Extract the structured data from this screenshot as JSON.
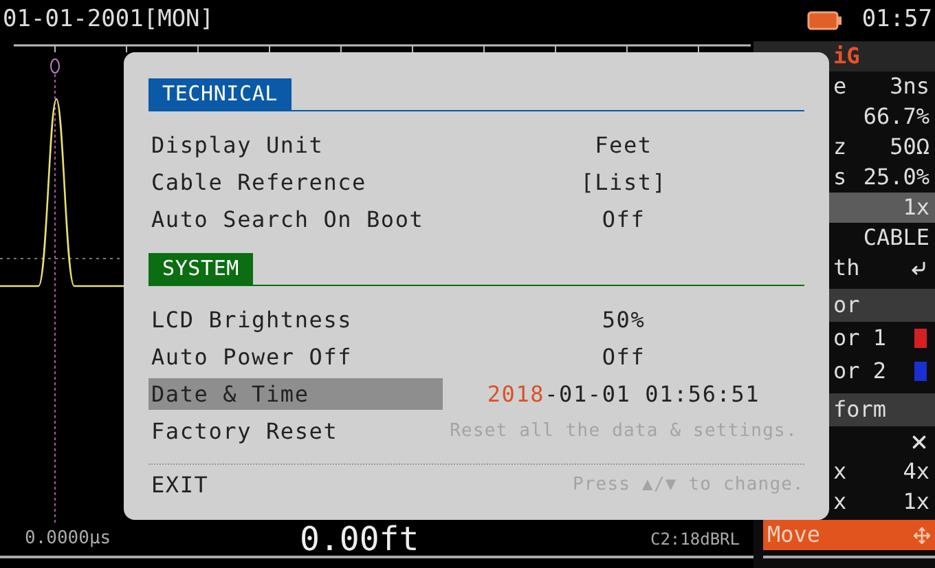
{
  "status_bar": {
    "date": "01-01-2001[MON]",
    "time": "01:57"
  },
  "readout": {
    "time": "0.0000µs",
    "distance": "0.00ft",
    "channel": "C2:18dBRL"
  },
  "config_panel": {
    "title": "iG",
    "rows": [
      {
        "kind": "value",
        "label": "e",
        "value": "3ns",
        "selected": false
      },
      {
        "kind": "value",
        "value": "66.7%",
        "selected": false
      },
      {
        "kind": "value",
        "label": "z",
        "value": "50Ω",
        "selected": false
      },
      {
        "kind": "value",
        "label": "s",
        "value": "25.0%",
        "selected": false
      },
      {
        "kind": "value",
        "value": "1x",
        "selected": true
      },
      {
        "kind": "value",
        "value": "CABLE",
        "selected": false
      },
      {
        "kind": "enter",
        "label": "th",
        "selected": false
      },
      {
        "kind": "header",
        "label": "or",
        "selected": false
      },
      {
        "kind": "swatch",
        "label": "or 1",
        "color": "#d42020",
        "selected": false
      },
      {
        "kind": "swatch",
        "label": "or 2",
        "color": "#1a2fd0",
        "selected": false
      },
      {
        "kind": "header",
        "label": "form",
        "selected": false
      },
      {
        "kind": "close",
        "selected": false
      },
      {
        "kind": "value",
        "label": "x",
        "value": "4x",
        "selected": false
      },
      {
        "kind": "value",
        "label": "x",
        "value": "1x",
        "selected": false
      },
      {
        "kind": "action",
        "label": "Move",
        "selected": false
      }
    ]
  },
  "dialog": {
    "sections": [
      {
        "title": "TECHNICAL",
        "color": "#0a5aa8",
        "rows": [
          {
            "label": "Display Unit",
            "value": "Feet",
            "selected": false
          },
          {
            "label": "Cable Reference",
            "value": "[List]",
            "selected": false
          },
          {
            "label": "Auto Search On Boot",
            "value": "Off",
            "selected": false
          }
        ]
      },
      {
        "title": "SYSTEM",
        "color": "#0b6e12",
        "rows": [
          {
            "label": "LCD Brightness",
            "value": "50%",
            "selected": false
          },
          {
            "label": "Auto Power Off",
            "value": "Off",
            "selected": false
          },
          {
            "label": "Date & Time",
            "selected": true,
            "value_parts": [
              {
                "text": "2018",
                "editing": true
              },
              {
                "text": "-01-01 01:56:51",
                "editing": false
              }
            ]
          },
          {
            "label": "Factory Reset",
            "hint": "Reset all the data & settings.",
            "selected": false
          }
        ]
      }
    ],
    "footer": {
      "label": "EXIT",
      "hint": "Press ▲/▼ to change."
    }
  }
}
